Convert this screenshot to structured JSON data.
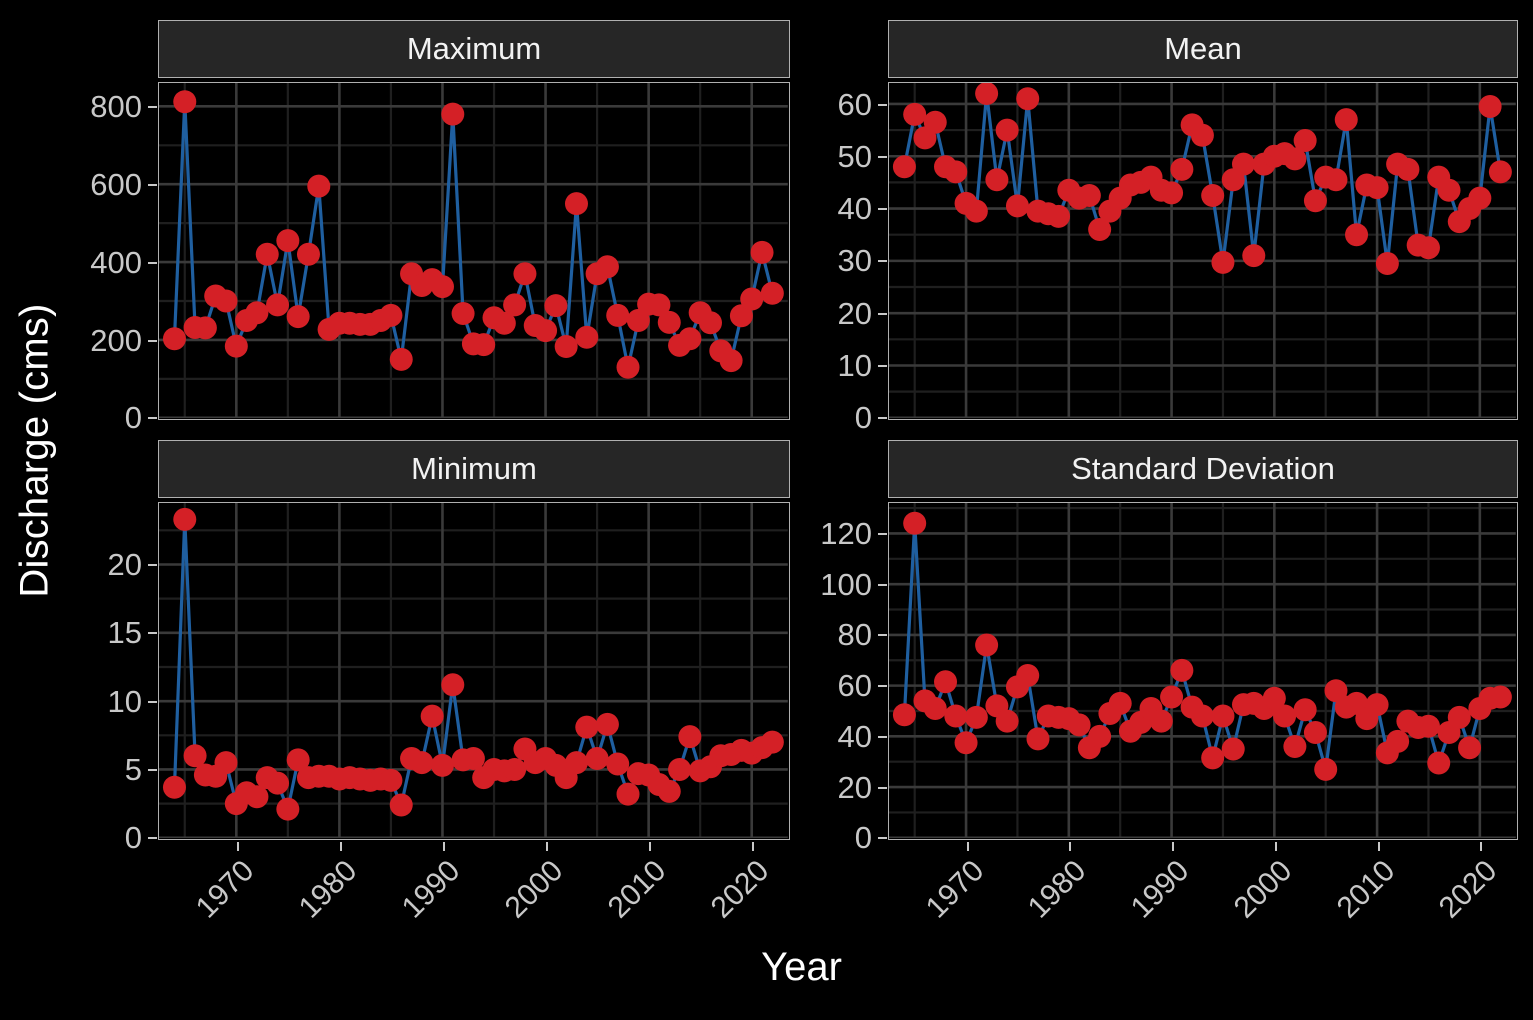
{
  "axes": {
    "ylabel": "Discharge (cms)",
    "xlabel": "Year"
  },
  "colors": {
    "background": "#000000",
    "panel_background": "#000000",
    "strip_background": "#262626",
    "strip_text": "#f2f2f2",
    "border": "#b0b0b0",
    "grid_major": "#3a3a3a",
    "grid_minor": "#1f1f1f",
    "point": "#d42026",
    "line": "#1f5fa0",
    "axis_text": "#c8c8c8",
    "axis_title": "#ffffff"
  },
  "facets": [
    {
      "label": "Maximum"
    },
    {
      "label": "Mean"
    },
    {
      "label": "Minimum"
    },
    {
      "label": "Standard Deviation"
    }
  ],
  "chart_data": {
    "type": "line",
    "title": "",
    "subtitle": "",
    "xlabel": "Year",
    "ylabel": "Discharge (cms)",
    "grid": true,
    "legend": "none",
    "marker": "filled-circle",
    "facet_layout": "2x2",
    "xlim": [
      1962.5,
      2023.5
    ],
    "xticks": [
      1970,
      1980,
      1990,
      2000,
      2010,
      2020
    ],
    "xticklabels": [
      "1970",
      "1980",
      "1990",
      "2000",
      "2010",
      "2020"
    ],
    "x": [
      1964,
      1965,
      1966,
      1967,
      1968,
      1969,
      1970,
      1971,
      1972,
      1973,
      1974,
      1975,
      1976,
      1977,
      1978,
      1979,
      1980,
      1981,
      1982,
      1983,
      1984,
      1985,
      1986,
      1987,
      1988,
      1989,
      1990,
      1991,
      1992,
      1993,
      1994,
      1995,
      1996,
      1997,
      1998,
      1999,
      2000,
      2001,
      2002,
      2003,
      2004,
      2005,
      2006,
      2007,
      2008,
      2009,
      2010,
      2011,
      2012,
      2013,
      2014,
      2015,
      2016,
      2017,
      2018,
      2019,
      2020,
      2021,
      2022
    ],
    "panels": [
      {
        "name": "Maximum",
        "ylim": [
          0,
          860
        ],
        "yticks": [
          0,
          200,
          400,
          600,
          800
        ],
        "yticklabels": [
          "0",
          "200",
          "400",
          "600",
          "800"
        ],
        "values": [
          203,
          812,
          232,
          231,
          313,
          300,
          184,
          250,
          270,
          420,
          290,
          455,
          260,
          420,
          595,
          227,
          243,
          243,
          240,
          240,
          250,
          263,
          150,
          370,
          340,
          355,
          337,
          780,
          268,
          190,
          188,
          257,
          243,
          290,
          370,
          237,
          224,
          288,
          183,
          550,
          207,
          370,
          388,
          263,
          130,
          250,
          292,
          290,
          245,
          186,
          203,
          270,
          244,
          172,
          147,
          262,
          305,
          425,
          320
        ]
      },
      {
        "name": "Mean",
        "ylim": [
          0,
          64
        ],
        "yticks": [
          0,
          10,
          20,
          30,
          40,
          50,
          60
        ],
        "yticklabels": [
          "0",
          "10",
          "20",
          "30",
          "40",
          "50",
          "60"
        ],
        "values": [
          48.0,
          58.0,
          53.5,
          56.5,
          48.0,
          47.0,
          41.0,
          39.5,
          62.0,
          45.5,
          55.0,
          40.5,
          61.0,
          39.5,
          39.0,
          38.5,
          43.5,
          42.0,
          42.5,
          36.0,
          39.5,
          42.0,
          44.5,
          45.0,
          46.0,
          43.5,
          43.0,
          47.5,
          56.0,
          54.0,
          42.5,
          29.7,
          45.5,
          48.5,
          31.0,
          48.5,
          50.0,
          50.5,
          49.5,
          53.0,
          41.5,
          46.0,
          45.5,
          57.0,
          35.0,
          44.5,
          44.0,
          29.5,
          48.5,
          47.5,
          33.0,
          32.5,
          46.0,
          43.5,
          37.5,
          40.0,
          42.0,
          59.5,
          47.0
        ]
      },
      {
        "name": "Minimum",
        "ylim": [
          0,
          24.5
        ],
        "yticks": [
          0,
          5,
          10,
          15,
          20
        ],
        "yticklabels": [
          "0",
          "5",
          "10",
          "15",
          "20"
        ],
        "values": [
          3.7,
          23.3,
          6.0,
          4.6,
          4.5,
          5.5,
          2.5,
          3.3,
          3.0,
          4.4,
          4.0,
          2.1,
          5.7,
          4.4,
          4.5,
          4.5,
          4.3,
          4.4,
          4.3,
          4.2,
          4.3,
          4.2,
          2.4,
          5.8,
          5.5,
          8.9,
          5.3,
          11.2,
          5.7,
          5.8,
          4.4,
          5.0,
          4.9,
          5.0,
          6.5,
          5.5,
          5.8,
          5.3,
          4.4,
          5.5,
          8.1,
          5.8,
          8.3,
          5.4,
          3.2,
          4.7,
          4.6,
          3.9,
          3.4,
          5.0,
          7.4,
          4.9,
          5.2,
          6.0,
          6.1,
          6.4,
          6.2,
          6.6,
          7.0
        ]
      },
      {
        "name": "Standard Deviation",
        "ylim": [
          0,
          132
        ],
        "yticks": [
          0,
          20,
          40,
          60,
          80,
          100,
          120
        ],
        "yticklabels": [
          "0",
          "20",
          "40",
          "60",
          "80",
          "100",
          "120"
        ],
        "values": [
          48.5,
          124.0,
          54.0,
          51.0,
          61.5,
          48.0,
          37.5,
          47.5,
          76.0,
          52.0,
          46.0,
          59.5,
          64.0,
          39.0,
          48.0,
          47.5,
          47.0,
          44.5,
          35.5,
          40.0,
          49.0,
          53.0,
          42.0,
          45.5,
          51.0,
          46.0,
          55.5,
          66.0,
          51.5,
          48.0,
          31.5,
          48.0,
          35.0,
          52.5,
          53.0,
          51.0,
          55.0,
          48.0,
          36.0,
          50.5,
          41.5,
          27.0,
          58.0,
          51.5,
          53.0,
          47.0,
          52.5,
          33.5,
          38.0,
          46.0,
          43.5,
          44.0,
          29.5,
          41.5,
          47.5,
          35.5,
          51.0,
          55.0,
          55.5
        ]
      }
    ]
  }
}
